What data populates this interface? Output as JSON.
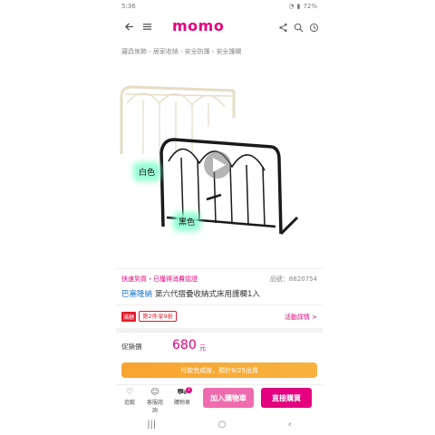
{
  "status": {
    "time": "5:36",
    "battery": "72%"
  },
  "header": {
    "logo": "momo"
  },
  "breadcrumb": [
    "寢具傢飾",
    "居家收納",
    "安全防護",
    "安全護欄"
  ],
  "product": {
    "color_labels": [
      "白色",
      "黑色"
    ],
    "tags": "快速到貨・已獲得消費認證",
    "sku": "品號：8820754",
    "brand": "巴塞隆納",
    "name": "第六代摺疊收納式床用護欄1入"
  },
  "promo": {
    "badge": "滿額",
    "text": "第2件享9折",
    "more": "活動詳情 >"
  },
  "price": {
    "label": "促銷價",
    "value": "680",
    "unit": "元"
  },
  "banner": {
    "text": "付款完成後，預計9/25出貨"
  },
  "bottombar": {
    "fav_label": "追蹤",
    "chat_label": "客服諮詢",
    "cart_label": "購物車",
    "cart_count": "2",
    "add_to_cart": "加入購物車",
    "buy_now": "直接購買"
  },
  "colors": {
    "brand": "#e4007f",
    "banner": "#f7a330",
    "brand_link": "#1a73c9"
  }
}
